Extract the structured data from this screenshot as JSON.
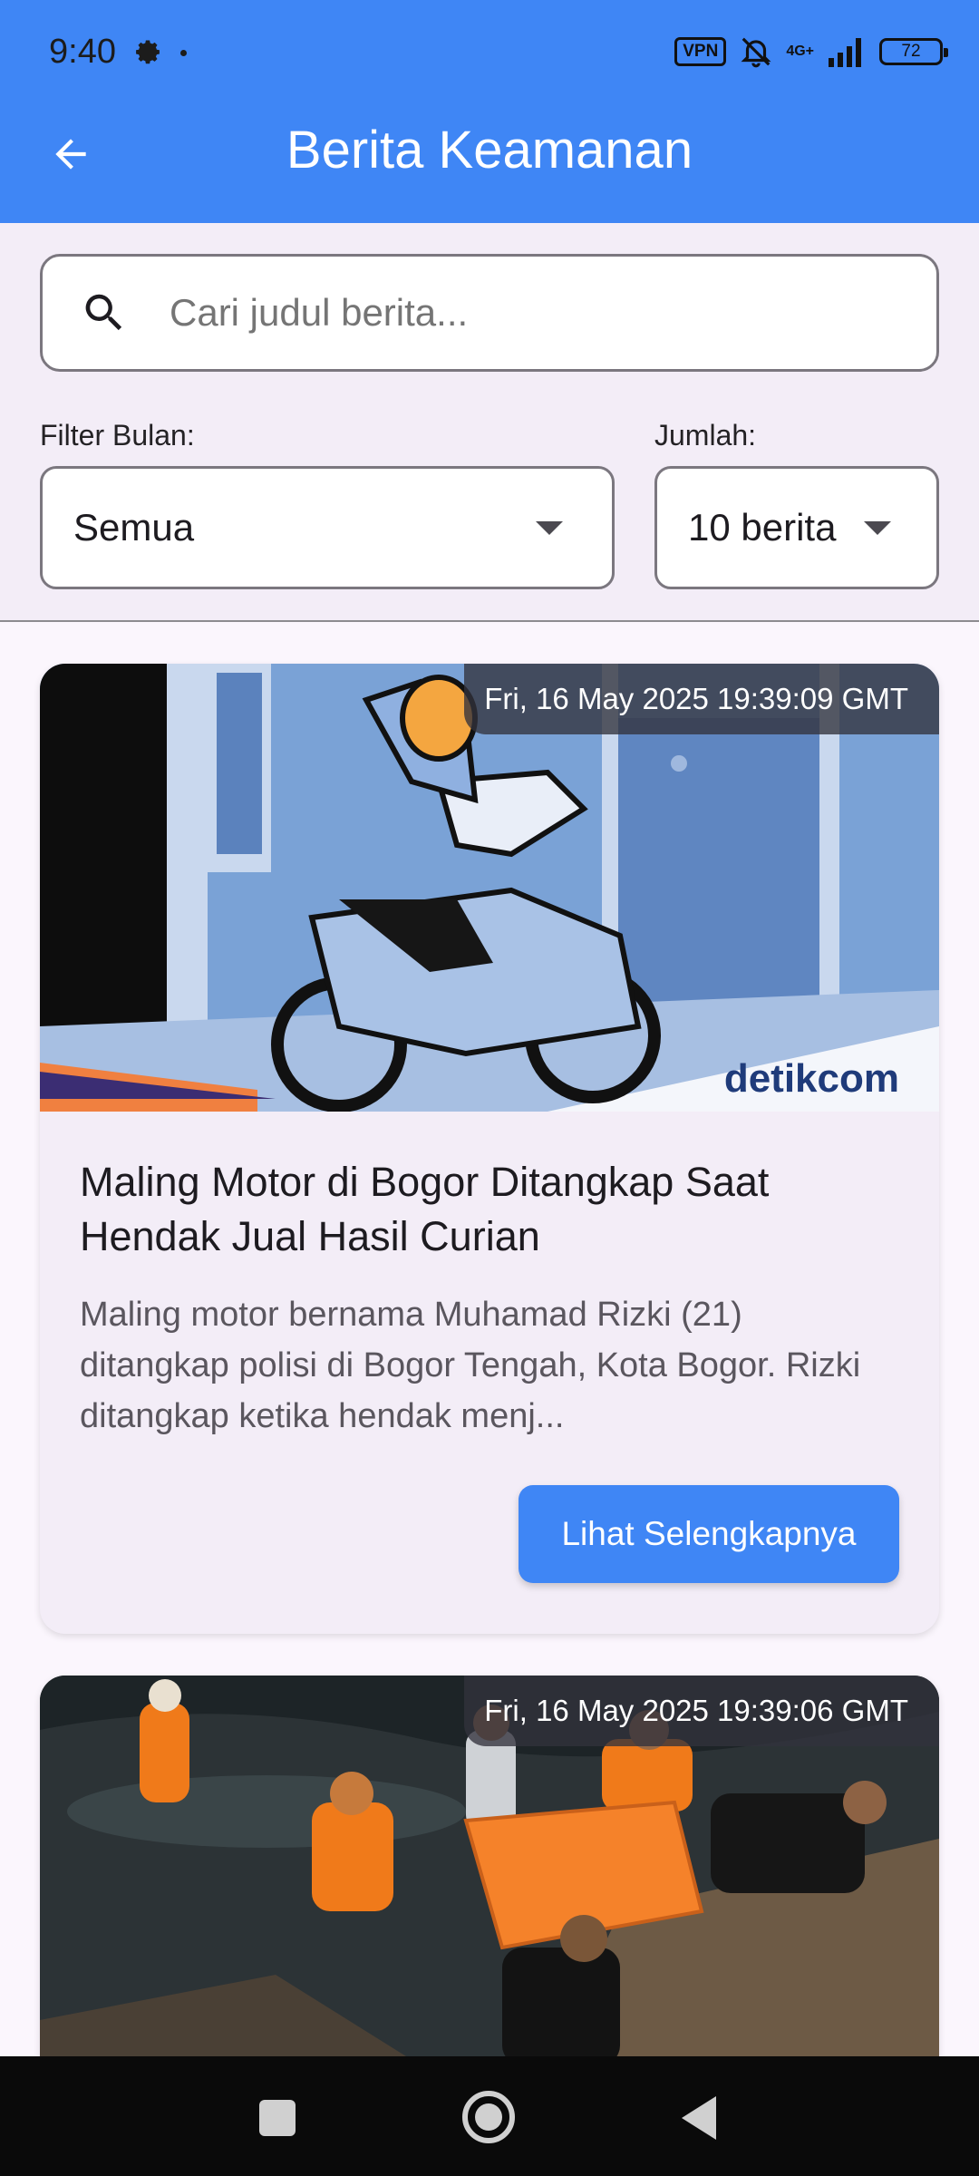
{
  "status_bar": {
    "time": "9:40",
    "vpn": "VPN",
    "network": "4G+",
    "battery": "72"
  },
  "app_bar": {
    "title": "Berita Keamanan",
    "background": "#3f86f5"
  },
  "search": {
    "placeholder": "Cari judul berita..."
  },
  "filters": {
    "month_label": "Filter Bulan:",
    "month_value": "Semua",
    "count_label": "Jumlah:",
    "count_value": "10 berita"
  },
  "articles": [
    {
      "date": "Fri, 16 May 2025 19:39:09 GMT",
      "title": "Maling Motor di Bogor Ditangkap Saat Hendak Jual Hasil Curian",
      "description": "Maling motor bernama Muhamad Rizki (21) ditangkap polisi di Bogor Tengah, Kota Bogor. Rizki ditangkap ketika hendak menj...",
      "button_label": "Lihat Selengkapnya",
      "image_watermark": "detikcom"
    },
    {
      "date": "Fri, 16 May 2025 19:39:06 GMT"
    }
  ]
}
